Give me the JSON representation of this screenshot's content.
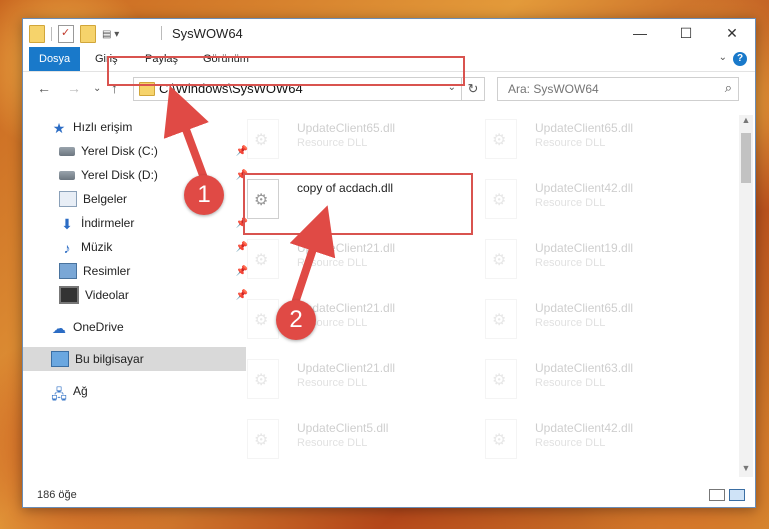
{
  "window": {
    "title": "SysWOW64"
  },
  "window_controls": {
    "minimize": "—",
    "maximize": "☐",
    "close": "✕"
  },
  "ribbon": {
    "tabs": [
      "Dosya",
      "Giriş",
      "Paylaş",
      "Görünüm"
    ]
  },
  "address": {
    "path": "C:\\Windows\\SysWOW64"
  },
  "search": {
    "placeholder": "Ara: SysWOW64"
  },
  "sidebar": {
    "items": [
      {
        "label": "Hızlı erişim",
        "icon": "star-icon"
      },
      {
        "label": "Yerel Disk (C:)",
        "icon": "disk-icon"
      },
      {
        "label": "Yerel Disk (D:)",
        "icon": "disk-icon"
      },
      {
        "label": "Belgeler",
        "icon": "documents-icon"
      },
      {
        "label": "İndirmeler",
        "icon": "download-icon"
      },
      {
        "label": "Müzik",
        "icon": "music-icon"
      },
      {
        "label": "Resimler",
        "icon": "pictures-icon"
      },
      {
        "label": "Videolar",
        "icon": "videos-icon"
      },
      {
        "label": "OneDrive",
        "icon": "cloud-icon"
      },
      {
        "label": "Bu bilgisayar",
        "icon": "computer-icon"
      },
      {
        "label": "Ağ",
        "icon": "network-icon"
      }
    ]
  },
  "files": [
    {
      "name": "UpdateClient65.dll",
      "type": "Resource DLL"
    },
    {
      "name": "UpdateClient65.dll",
      "type": "Resource DLL"
    },
    {
      "name": "copy of acdach.dll",
      "type": ""
    },
    {
      "name": "UpdateClient42.dll",
      "type": "Resource DLL"
    },
    {
      "name": "UpdateClient21.dll",
      "type": "Resource DLL"
    },
    {
      "name": "UpdateClient19.dll",
      "type": "Resource DLL"
    },
    {
      "name": "UpdateClient21.dll",
      "type": "Resource DLL"
    },
    {
      "name": "UpdateClient65.dll",
      "type": "Resource DLL"
    },
    {
      "name": "UpdateClient21.dll",
      "type": "Resource DLL"
    },
    {
      "name": "UpdateClient63.dll",
      "type": "Resource DLL"
    },
    {
      "name": "UpdateClient5.dll",
      "type": "Resource DLL"
    },
    {
      "name": "UpdateClient42.dll",
      "type": "Resource DLL"
    }
  ],
  "status": {
    "item_count": "186 öğe"
  },
  "annotations": {
    "badge1": "1",
    "badge2": "2"
  },
  "colors": {
    "accent": "#1979ca",
    "highlight": "#d9534f"
  }
}
